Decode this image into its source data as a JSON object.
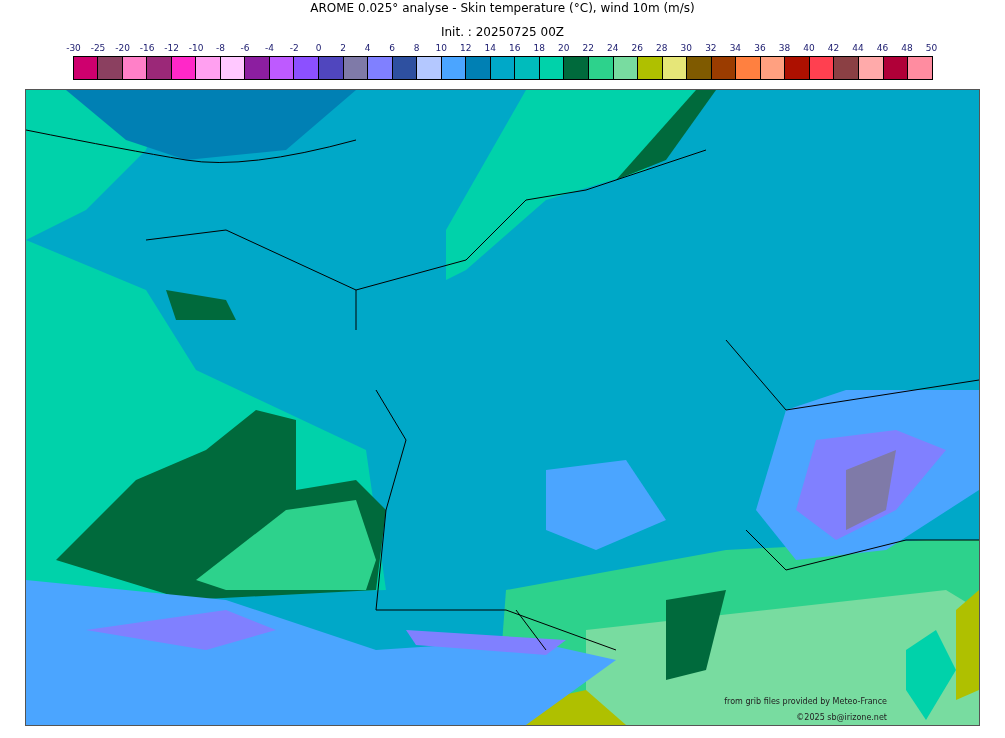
{
  "title": "AROME 0.025° analyse - Skin temperature (°C), wind 10m (m/s)",
  "subtitle": "Init. : 20250725 00Z",
  "colorbar": {
    "ticks": [
      "-30",
      "-25",
      "-20",
      "-16",
      "-12",
      "-10",
      "-8",
      "-6",
      "-4",
      "-2",
      "0",
      "2",
      "4",
      "6",
      "8",
      "10",
      "12",
      "14",
      "16",
      "18",
      "20",
      "22",
      "24",
      "26",
      "28",
      "30",
      "32",
      "34",
      "36",
      "38",
      "40",
      "42",
      "44",
      "46",
      "48",
      "50"
    ],
    "cells": [
      {
        "color": "#ce006e"
      },
      {
        "color": "#8b4060"
      },
      {
        "color": "#ff80c8"
      },
      {
        "color": "#9b2878"
      },
      {
        "color": "#ff28c8"
      },
      {
        "color": "#ffa0f0"
      },
      {
        "color": "#ffc8ff"
      },
      {
        "color": "#8c1ea0"
      },
      {
        "color": "#be5aff"
      },
      {
        "color": "#8c50ff"
      },
      {
        "color": "#5046be"
      },
      {
        "color": "#7f7aa8"
      },
      {
        "color": "#8080ff"
      },
      {
        "color": "#2e50a0"
      },
      {
        "color": "#b4c8ff"
      },
      {
        "color": "#4ba5ff"
      },
      {
        "color": "#0080b4"
      },
      {
        "color": "#00a8c8"
      },
      {
        "color": "#00bcbc"
      },
      {
        "color": "#00d2aa"
      },
      {
        "color": "#006a3c"
      },
      {
        "color": "#2dd28c"
      },
      {
        "color": "#78dca0"
      },
      {
        "color": "#afc000"
      },
      {
        "color": "#e6e678"
      },
      {
        "color": "#7f5a00"
      },
      {
        "color": "#9b3c00"
      },
      {
        "color": "#ff8040"
      },
      {
        "color": "#ffa080"
      },
      {
        "color": "#ad1000"
      },
      {
        "color": "#ff4050"
      },
      {
        "color": "#8b4044"
      },
      {
        "color": "#ffaaaa"
      },
      {
        "color": "#b00038"
      },
      {
        "color": "#ff8ca0"
      }
    ]
  },
  "credits": [
    "from grib files provided by Meteo-France",
    "©2025 sb@irizone.net"
  ]
}
